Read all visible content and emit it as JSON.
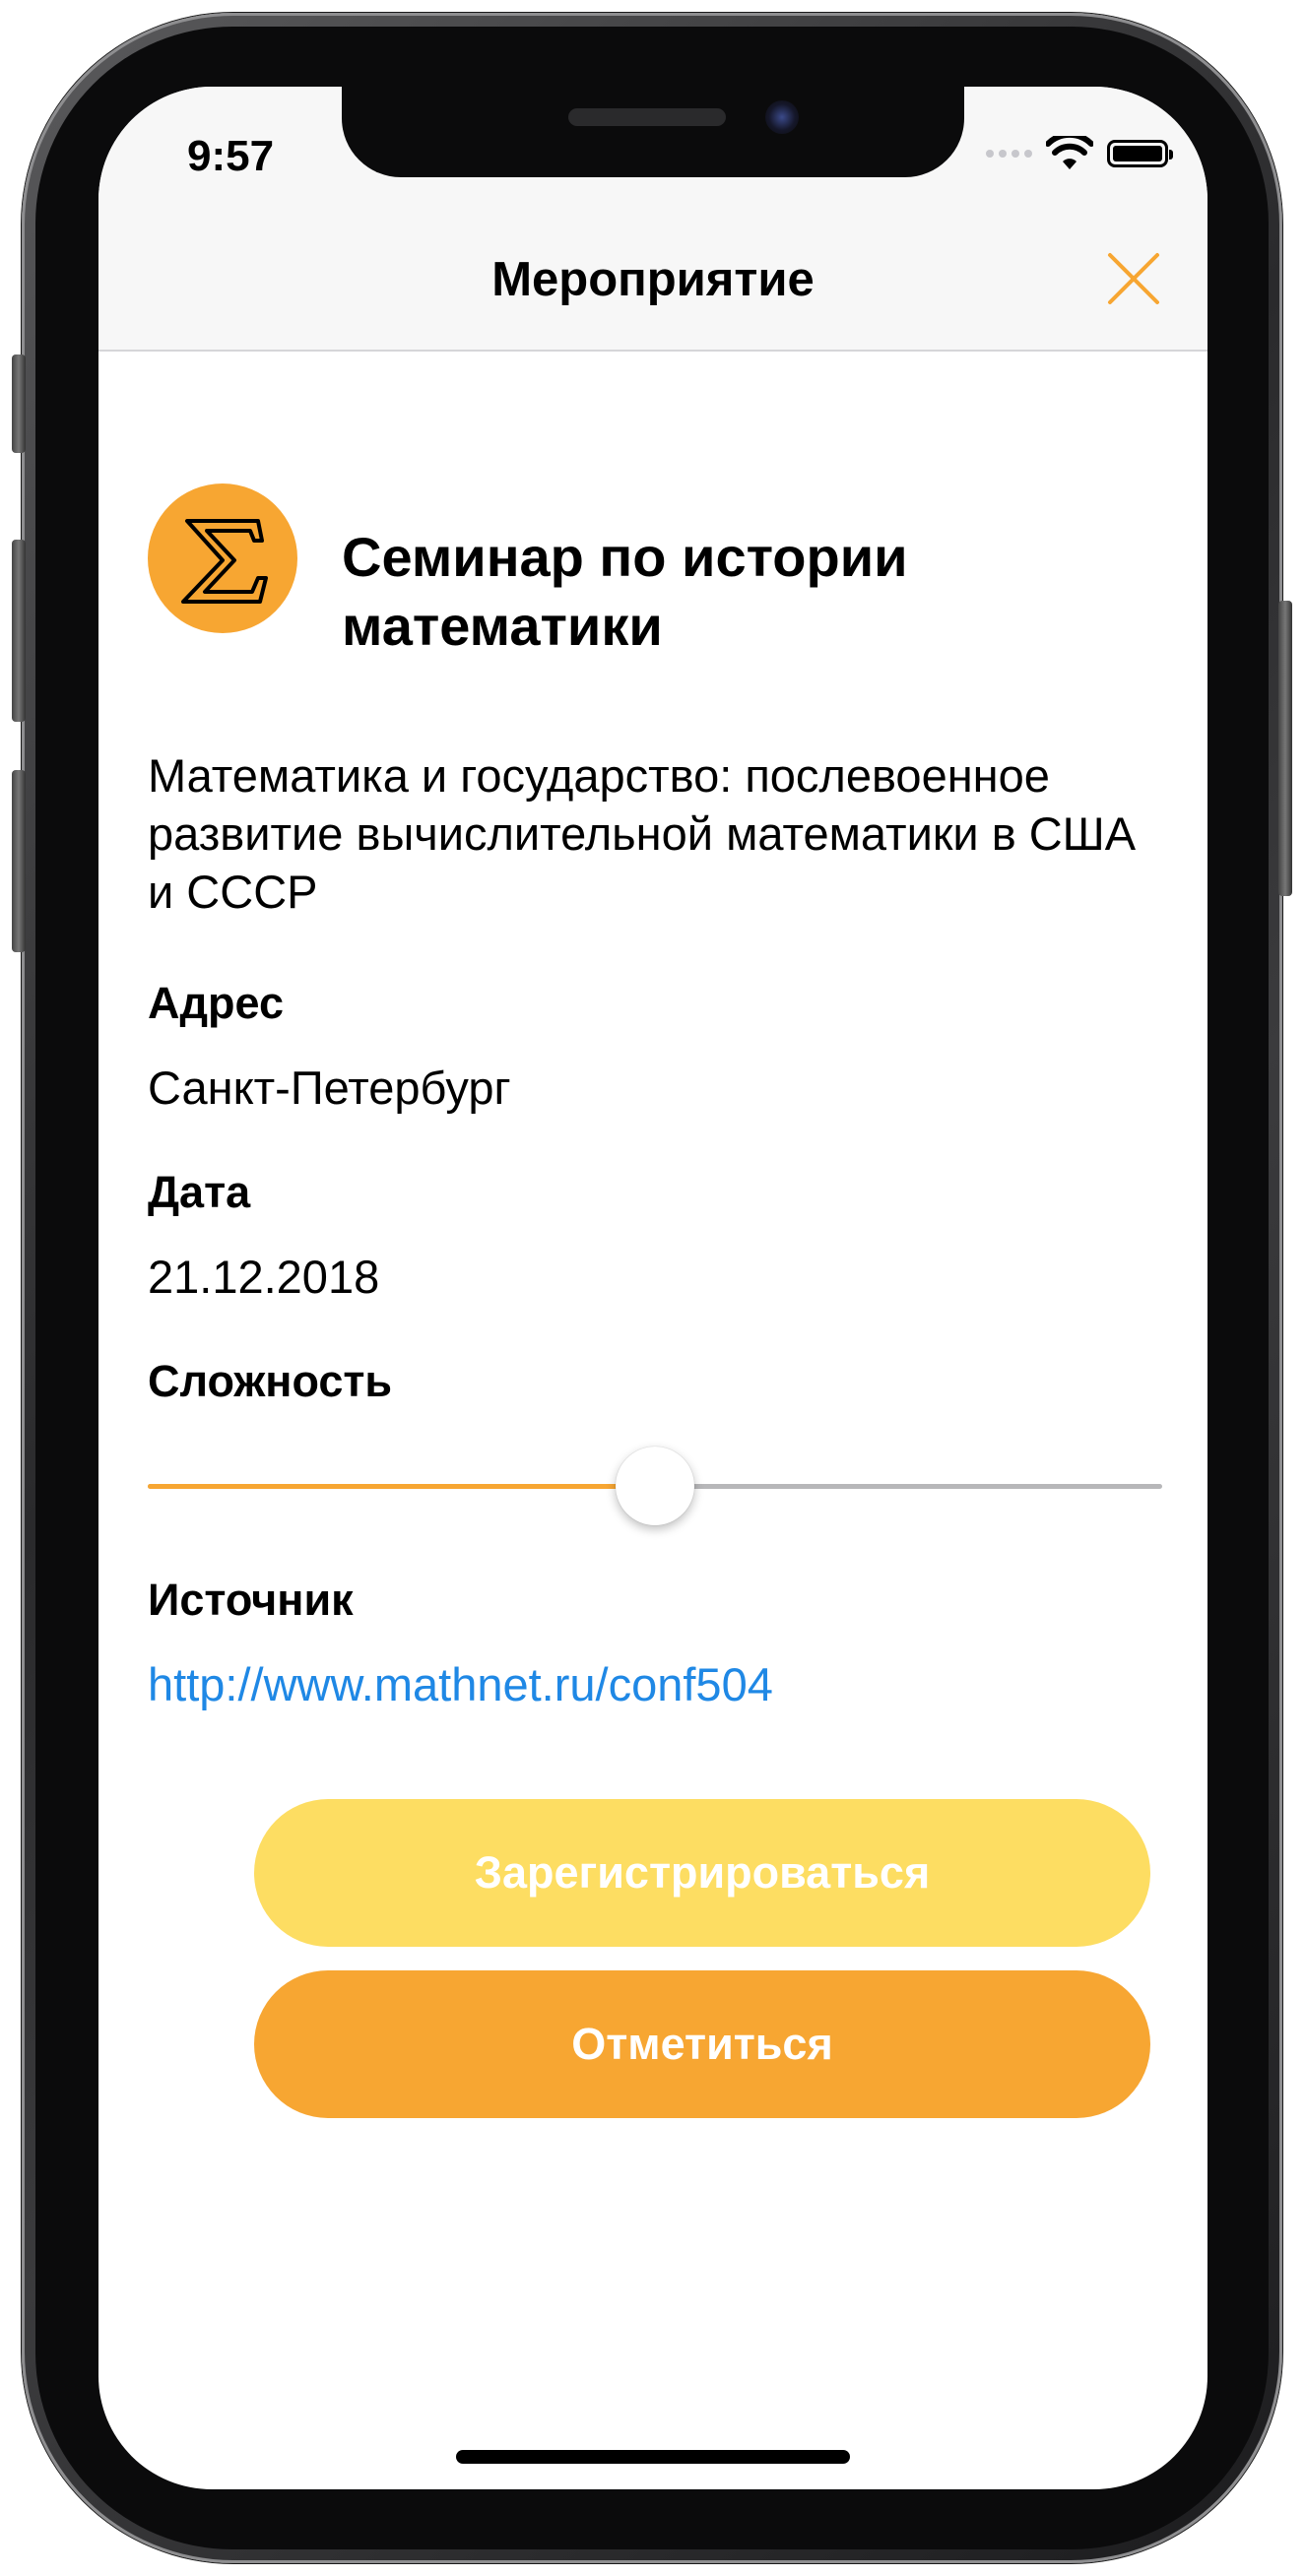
{
  "status_bar": {
    "time": "9:57"
  },
  "navbar": {
    "title": "Мероприятие",
    "close_icon": "close-icon"
  },
  "event": {
    "logo_icon": "sigma-icon",
    "title": "Семинар по истории математики",
    "description": "Математика и государство: послевоенное развитие вычислительной математики в США и СССР"
  },
  "address": {
    "label": "Адрес",
    "value": "Санкт-Петербург"
  },
  "date": {
    "label": "Дата",
    "value": "21.12.2018"
  },
  "difficulty": {
    "label": "Сложность",
    "level_percent": 50
  },
  "source": {
    "label": "Источник",
    "url": "http://www.mathnet.ru/conf504"
  },
  "buttons": {
    "register": "Зарегистрироваться",
    "check_in": "Отметиться"
  },
  "colors": {
    "accent": "#f7a632",
    "register_button": "#fddd62",
    "link": "#1f88e5",
    "slider_track": "#b7b7b9"
  }
}
